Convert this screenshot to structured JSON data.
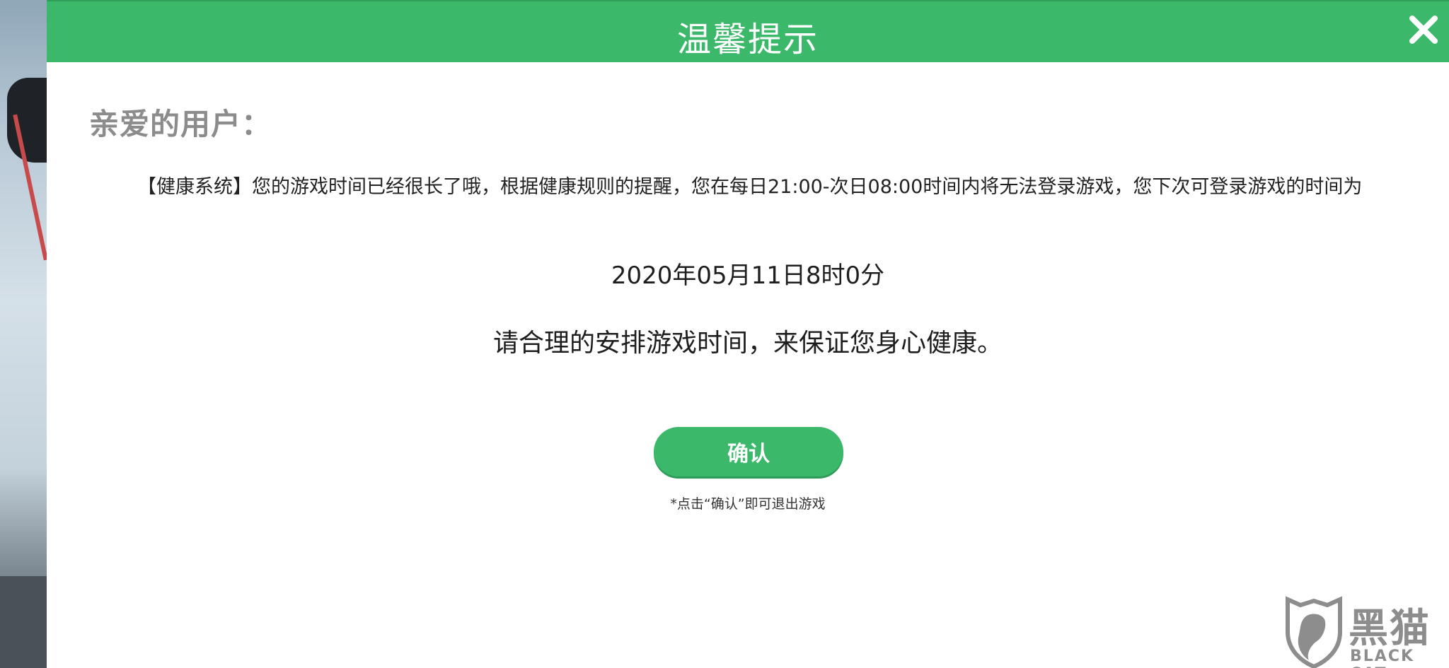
{
  "dialog": {
    "title": "温馨提示",
    "greeting": "亲爱的用户：",
    "message": "【健康系统】您的游戏时间已经很长了哦，根据健康规则的提醒，您在每日21:00-次日08:00时间内将无法登录游戏，您下次可登录游戏的时间为",
    "next_login_time": "2020年05月11日8时0分",
    "advice": "请合理的安排游戏时间，来保证您身心健康。",
    "confirm_label": "确认",
    "exit_note": "*点击“确认”即可退出游戏",
    "close_icon": "close-icon"
  },
  "watermark": {
    "title": "黑猫",
    "subtitle": "BLACK CAT"
  },
  "colors": {
    "accent": "#3cb86b",
    "greeting": "#8c8c8c",
    "text": "#222222"
  }
}
